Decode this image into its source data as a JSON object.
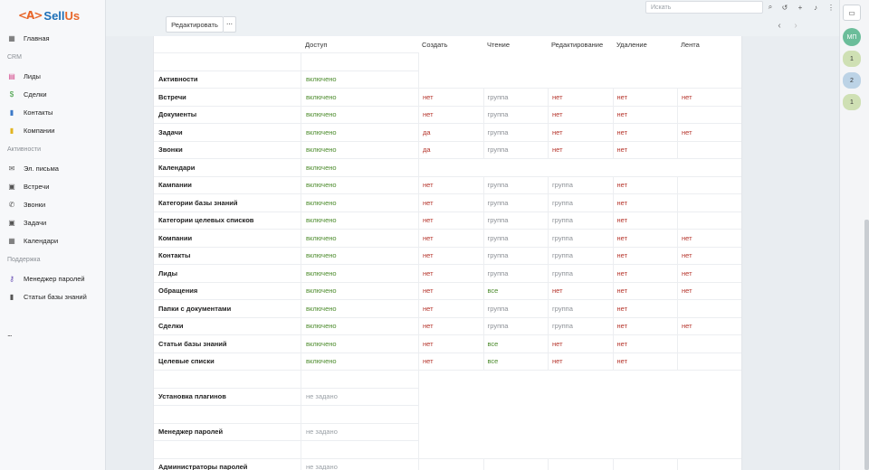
{
  "app": {
    "logo_mark": "<A>",
    "brand_sell": "Sell",
    "brand_us": "Us"
  },
  "sidebar": {
    "items": [
      {
        "label": "Главная",
        "icon": "grid-icon"
      },
      {
        "label": "Лиды",
        "icon": "id-card-icon"
      },
      {
        "label": "Сделки",
        "icon": "dollar-icon"
      },
      {
        "label": "Контакты",
        "icon": "contact-book-icon"
      },
      {
        "label": "Компании",
        "icon": "building-icon"
      },
      {
        "label": "Эл. письма",
        "icon": "envelope-icon"
      },
      {
        "label": "Встречи",
        "icon": "calendar-event-icon"
      },
      {
        "label": "Звонки",
        "icon": "phone-icon"
      },
      {
        "label": "Задачи",
        "icon": "tasks-icon"
      },
      {
        "label": "Календари",
        "icon": "calendar-icon"
      },
      {
        "label": "Менеджер паролей",
        "icon": "key-icon"
      },
      {
        "label": "Статьи базы знаний",
        "icon": "book-icon"
      }
    ],
    "sections": {
      "crm": "CRM",
      "activities": "Активности",
      "support": "Поддержка"
    },
    "more": "..."
  },
  "toolbar": {
    "edit_label": "Редактировать",
    "more_label": "⋯",
    "search_placeholder": "Искать"
  },
  "right_panel": {
    "avatar_initials": "МП",
    "badges": [
      "1",
      "2",
      "1"
    ]
  },
  "table": {
    "columns": [
      "Доступ",
      "Создать",
      "Чтение",
      "Редактирование",
      "Удаление",
      "Лента"
    ],
    "rows": [
      {
        "name": "Активности",
        "access": "включено",
        "perms": []
      },
      {
        "name": "Встречи",
        "access": "включено",
        "perms": [
          "нет",
          "группа",
          "нет",
          "нет",
          "нет"
        ]
      },
      {
        "name": "Документы",
        "access": "включено",
        "perms": [
          "нет",
          "группа",
          "нет",
          "нет",
          ""
        ]
      },
      {
        "name": "Задачи",
        "access": "включено",
        "perms": [
          "да",
          "группа",
          "нет",
          "нет",
          "нет"
        ]
      },
      {
        "name": "Звонки",
        "access": "включено",
        "perms": [
          "да",
          "группа",
          "нет",
          "нет",
          ""
        ]
      },
      {
        "name": "Календари",
        "access": "включено",
        "perms": []
      },
      {
        "name": "Кампании",
        "access": "включено",
        "perms": [
          "нет",
          "группа",
          "группа",
          "нет",
          ""
        ]
      },
      {
        "name": "Категории базы знаний",
        "access": "включено",
        "perms": [
          "нет",
          "группа",
          "группа",
          "нет",
          ""
        ]
      },
      {
        "name": "Категории целевых списков",
        "access": "включено",
        "perms": [
          "нет",
          "группа",
          "группа",
          "нет",
          ""
        ]
      },
      {
        "name": "Компании",
        "access": "включено",
        "perms": [
          "нет",
          "группа",
          "группа",
          "нет",
          "нет"
        ]
      },
      {
        "name": "Контакты",
        "access": "включено",
        "perms": [
          "нет",
          "группа",
          "группа",
          "нет",
          "нет"
        ]
      },
      {
        "name": "Лиды",
        "access": "включено",
        "perms": [
          "нет",
          "группа",
          "группа",
          "нет",
          "нет"
        ]
      },
      {
        "name": "Обращения",
        "access": "включено",
        "perms": [
          "нет",
          "все",
          "нет",
          "нет",
          "нет"
        ]
      },
      {
        "name": "Папки с документами",
        "access": "включено",
        "perms": [
          "нет",
          "группа",
          "группа",
          "нет",
          ""
        ]
      },
      {
        "name": "Сделки",
        "access": "включено",
        "perms": [
          "нет",
          "группа",
          "группа",
          "нет",
          "нет"
        ]
      },
      {
        "name": "Статьи базы знаний",
        "access": "включено",
        "perms": [
          "нет",
          "все",
          "нет",
          "нет",
          ""
        ]
      },
      {
        "name": "Целевые списки",
        "access": "включено",
        "perms": [
          "нет",
          "все",
          "нет",
          "нет",
          ""
        ]
      }
    ],
    "extra_rows": [
      {
        "name": "Установка плагинов",
        "access": "не задано"
      },
      {
        "name": "Менеджер паролей",
        "access": "не задано"
      },
      {
        "name": "Администраторы паролей",
        "access": "не задано"
      }
    ]
  }
}
